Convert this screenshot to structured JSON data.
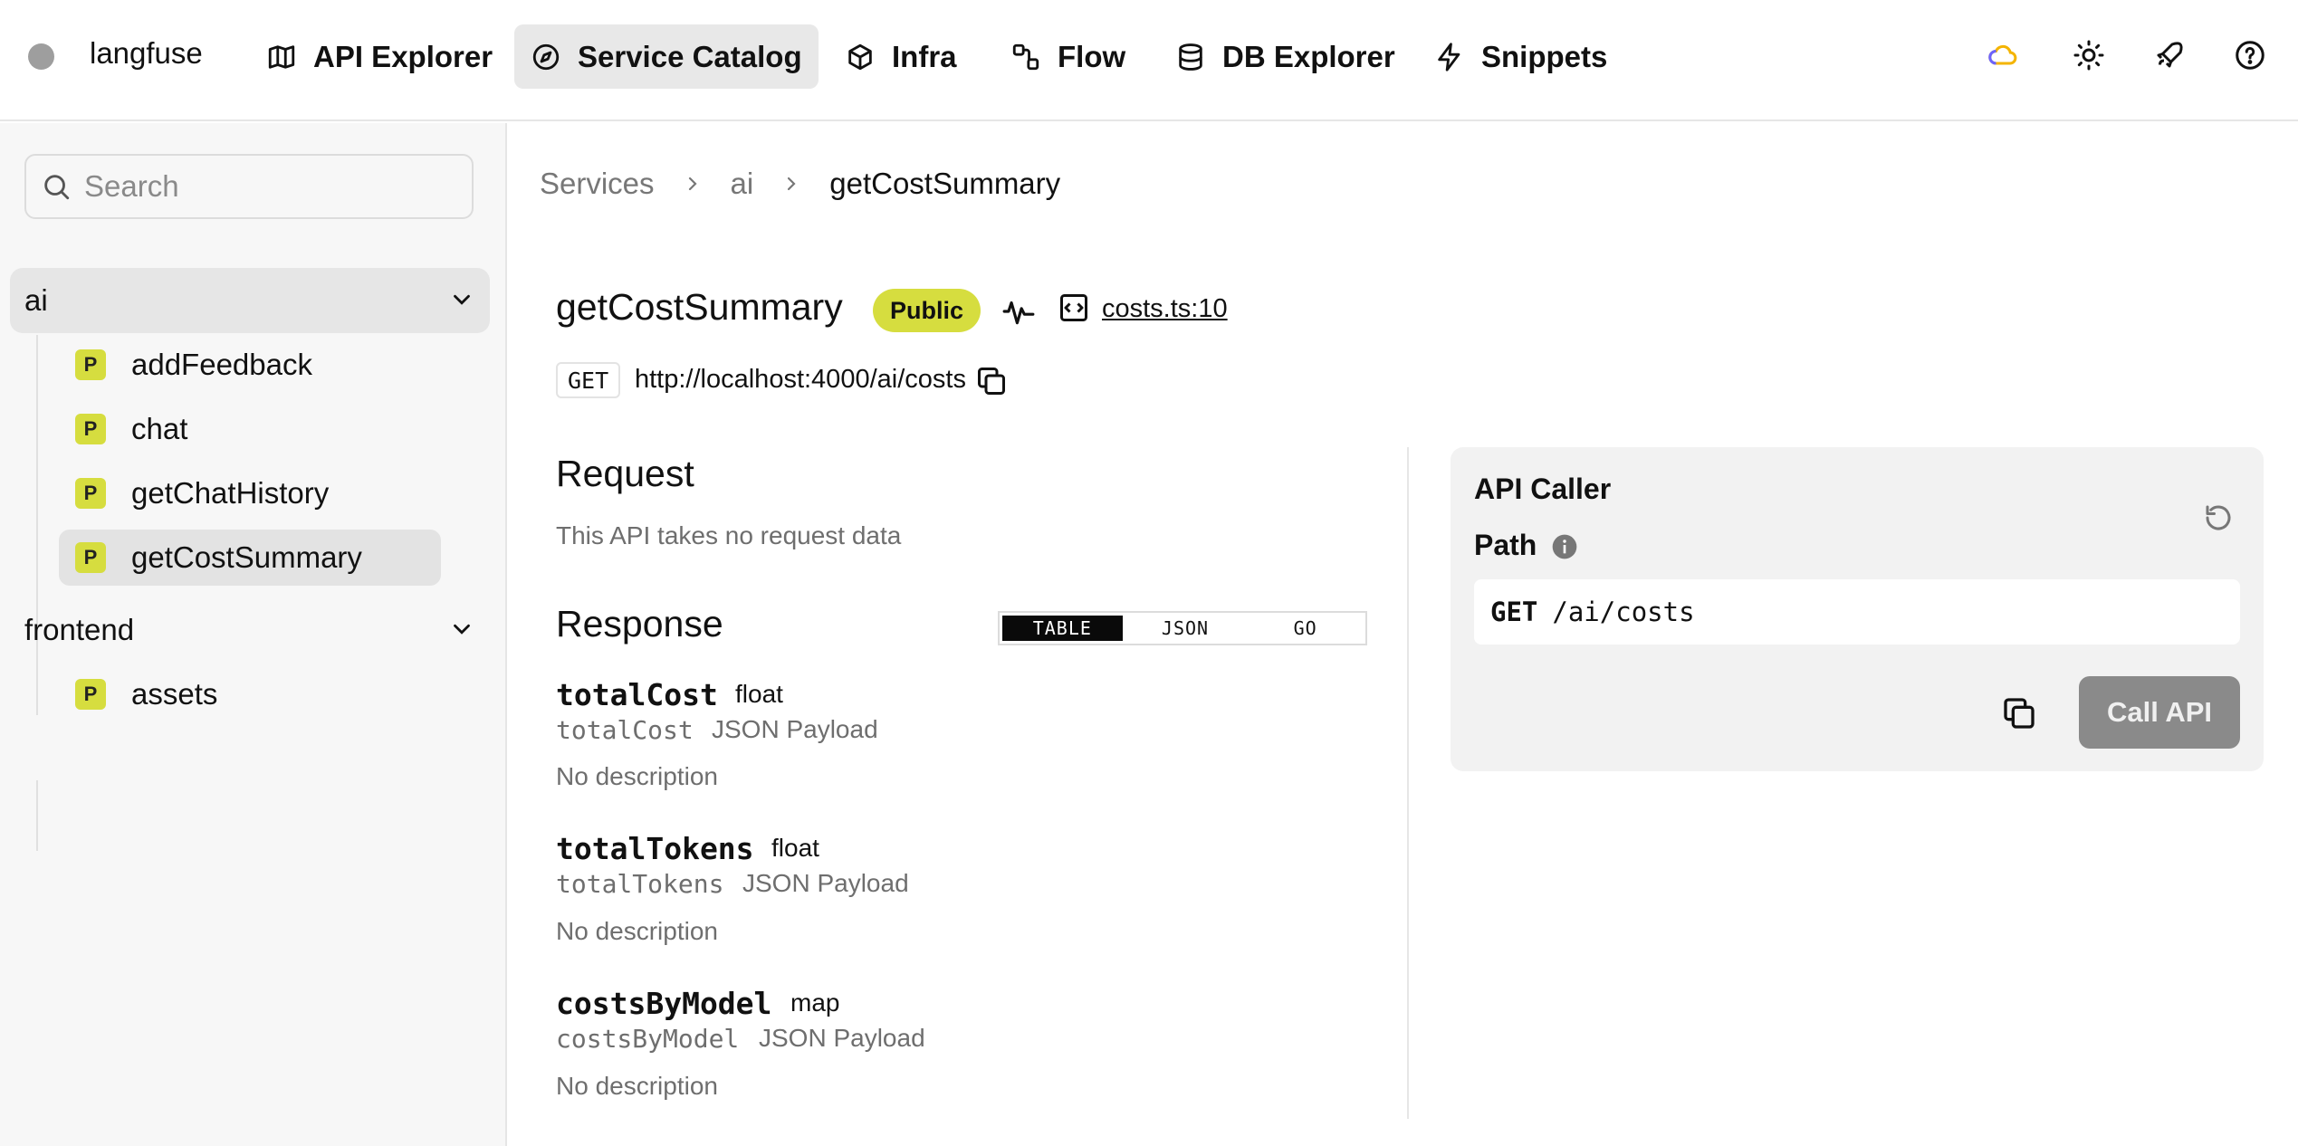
{
  "app": {
    "name": "langfuse"
  },
  "nav": {
    "items": [
      {
        "label": "API Explorer",
        "icon": "map-icon"
      },
      {
        "label": "Service Catalog",
        "icon": "compass-icon",
        "active": true
      },
      {
        "label": "Infra",
        "icon": "box-icon"
      },
      {
        "label": "Flow",
        "icon": "flow-icon"
      },
      {
        "label": "DB Explorer",
        "icon": "database-icon"
      },
      {
        "label": "Snippets",
        "icon": "bolt-icon"
      }
    ],
    "right_icons": [
      "cloud-icon",
      "sun-icon",
      "rocket-icon",
      "help-icon"
    ],
    "cloud_colors": [
      "#6c63ff",
      "#f4b400"
    ]
  },
  "sidebar": {
    "search_placeholder": "Search",
    "groups": [
      {
        "name": "ai",
        "expanded": true,
        "items": [
          {
            "badge": "P",
            "label": "addFeedback"
          },
          {
            "badge": "P",
            "label": "chat"
          },
          {
            "badge": "P",
            "label": "getChatHistory"
          },
          {
            "badge": "P",
            "label": "getCostSummary",
            "active": true
          }
        ]
      },
      {
        "name": "frontend",
        "expanded": true,
        "items": [
          {
            "badge": "P",
            "label": "assets"
          }
        ]
      }
    ]
  },
  "breadcrumb": [
    "Services",
    "ai",
    "getCostSummary"
  ],
  "endpoint": {
    "name": "getCostSummary",
    "visibility": "Public",
    "source": "costs.ts:10",
    "method": "GET",
    "url": "http://localhost:4000/ai/costs"
  },
  "request": {
    "title": "Request",
    "empty_text": "This API takes no request data"
  },
  "response": {
    "title": "Response",
    "tabs": [
      "TABLE",
      "JSON",
      "GO"
    ],
    "active_tab": "TABLE",
    "fields": [
      {
        "name": "totalCost",
        "type": "float",
        "key": "totalCost",
        "source": "JSON Payload",
        "description": "No description"
      },
      {
        "name": "totalTokens",
        "type": "float",
        "key": "totalTokens",
        "source": "JSON Payload",
        "description": "No description"
      },
      {
        "name": "costsByModel",
        "type": "map",
        "key": "costsByModel",
        "source": "JSON Payload",
        "description": "No description"
      }
    ]
  },
  "caller": {
    "title": "API Caller",
    "path_label": "Path",
    "method": "GET",
    "path": "/ai/costs",
    "call_label": "Call API"
  },
  "colors": {
    "badge": "#d6dd3f",
    "accent_dark": "#0a0a0a",
    "call_button": "#8a8a8a"
  }
}
